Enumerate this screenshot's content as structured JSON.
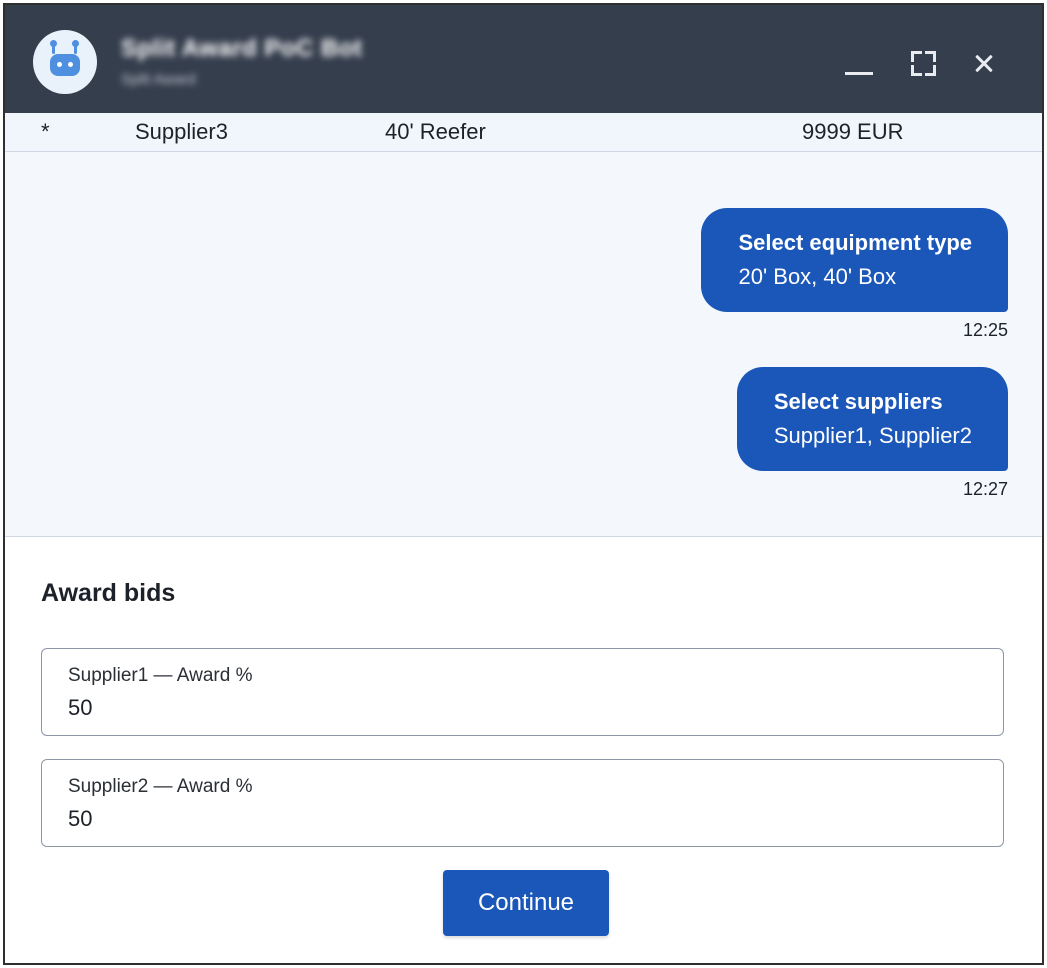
{
  "header": {
    "bot_name": "Split Award PoC Bot",
    "bot_subtitle": "Split Award",
    "minimize_icon": "minimize-icon",
    "expand_icon": "expand-icon",
    "close_icon": "close-icon",
    "background": "#353e4d"
  },
  "table_row": {
    "marker": "*",
    "supplier": "Supplier3",
    "equipment": "40' Reefer",
    "price": "9999 EUR"
  },
  "chat": {
    "messages": [
      {
        "title": "Select equipment type",
        "body": "20' Box, 40' Box",
        "time": "12:25"
      },
      {
        "title": "Select suppliers",
        "body": "Supplier1, Supplier2",
        "time": "12:27"
      }
    ],
    "bubble_color": "#1b57b8"
  },
  "form": {
    "title": "Award bids",
    "fields": [
      {
        "label": "Supplier1 — Award %",
        "value": "50"
      },
      {
        "label": "Supplier2 — Award %",
        "value": "50"
      }
    ],
    "continue_label": "Continue"
  }
}
